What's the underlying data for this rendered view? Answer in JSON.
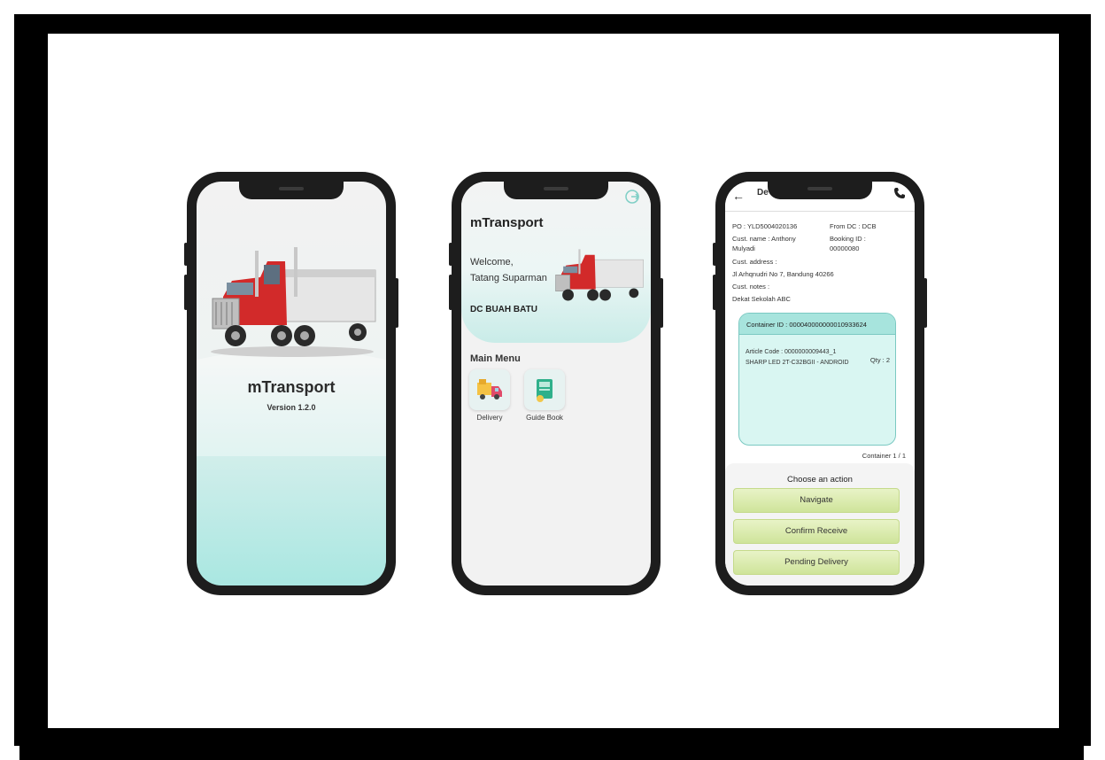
{
  "splash": {
    "app_name": "mTransport",
    "version": "Version 1.2.0"
  },
  "home": {
    "app_name": "mTransport",
    "welcome_line1": "Welcome,",
    "welcome_line2": "Tatang Suparman",
    "dc_name": "DC BUAH BATU",
    "menu_title": "Main Menu",
    "menu_items": [
      {
        "label": "Delivery",
        "icon": "delivery-truck-icon"
      },
      {
        "label": "Guide Book",
        "icon": "guide-book-icon"
      }
    ]
  },
  "detail": {
    "title_partial": "De",
    "po": "PO : YLD5004020136",
    "from_dc": "From DC : DCB",
    "cust_name_label": "Cust. name : Anthony",
    "cust_name_line2": "Mulyadi",
    "booking_label": "Booking ID :",
    "booking_id": "00000080",
    "address_label": "Cust. address :",
    "address": "Jl Arhqnudri No 7, Bandung 40266",
    "notes_label": "Cust. notes :",
    "notes": "Dekat Sekolah ABC",
    "container_id": "Container ID : 000040000000010933624",
    "article_code": "Article Code : 0000000009443_1",
    "article_name": "SHARP LED 2T-C32BGII - ANDROID",
    "qty": "Qty : 2",
    "container_count": "Container 1 / 1",
    "action_title": "Choose an action",
    "actions": [
      "Navigate",
      "Confirm Receive",
      "Pending Delivery"
    ]
  },
  "colors": {
    "accent_teal": "#a9e7e1",
    "button_green": "#cfe49a",
    "truck_red": "#d22a2a"
  }
}
